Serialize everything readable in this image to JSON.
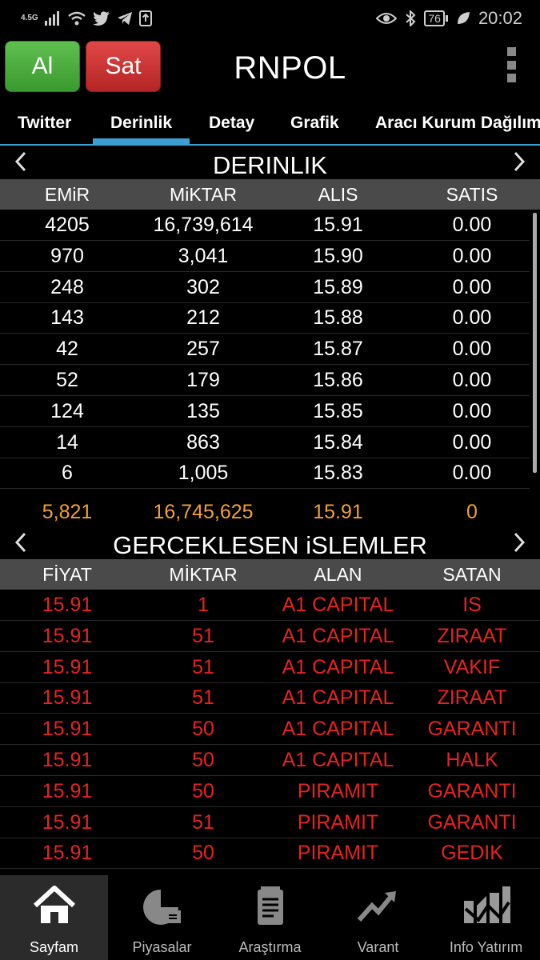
{
  "statusbar": {
    "network": "4.5G",
    "battery": "76",
    "time": "20:02"
  },
  "header": {
    "buy_label": "Al",
    "sell_label": "Sat",
    "symbol": "RNPOL"
  },
  "tabs": [
    "Twitter",
    "Derinlik",
    "Detay",
    "Grafik",
    "Aracı Kurum Dağılımı"
  ],
  "depth": {
    "title": "DERINLIK",
    "columns": [
      "EMiR",
      "MiKTAR",
      "ALIS",
      "SATIS"
    ],
    "rows": [
      [
        "4205",
        "16,739,614",
        "15.91",
        "0.00"
      ],
      [
        "970",
        "3,041",
        "15.90",
        "0.00"
      ],
      [
        "248",
        "302",
        "15.89",
        "0.00"
      ],
      [
        "143",
        "212",
        "15.88",
        "0.00"
      ],
      [
        "42",
        "257",
        "15.87",
        "0.00"
      ],
      [
        "52",
        "179",
        "15.86",
        "0.00"
      ],
      [
        "124",
        "135",
        "15.85",
        "0.00"
      ],
      [
        "14",
        "863",
        "15.84",
        "0.00"
      ],
      [
        "6",
        "1,005",
        "15.83",
        "0.00"
      ]
    ],
    "totals": [
      "5,821",
      "16,745,625",
      "15.91",
      "0"
    ]
  },
  "trades": {
    "title": "GERCEKLESEN iSLEMLER",
    "columns": [
      "FİYAT",
      "MİKTAR",
      "ALAN",
      "SATAN"
    ],
    "rows": [
      [
        "15.91",
        "1",
        "A1 CAPITAL",
        "IS"
      ],
      [
        "15.91",
        "51",
        "A1 CAPITAL",
        "ZIRAAT"
      ],
      [
        "15.91",
        "51",
        "A1 CAPITAL",
        "VAKIF"
      ],
      [
        "15.91",
        "51",
        "A1 CAPITAL",
        "ZIRAAT"
      ],
      [
        "15.91",
        "50",
        "A1 CAPITAL",
        "GARANTI"
      ],
      [
        "15.91",
        "50",
        "A1 CAPITAL",
        "HALK"
      ],
      [
        "15.91",
        "50",
        "PIRAMIT",
        "GARANTI"
      ],
      [
        "15.91",
        "51",
        "PIRAMIT",
        "GARANTI"
      ],
      [
        "15.91",
        "50",
        "PIRAMIT",
        "GEDIK"
      ]
    ]
  },
  "bottomnav": [
    {
      "label": "Sayfam",
      "icon": "home-icon"
    },
    {
      "label": "Piyasalar",
      "icon": "pie-chart-icon"
    },
    {
      "label": "Araştırma",
      "icon": "document-icon"
    },
    {
      "label": "Varant",
      "icon": "trend-arrow-icon"
    },
    {
      "label": "Info Yatırım",
      "icon": "info-logo-icon"
    }
  ],
  "colors": {
    "buy": "#3a9a2e",
    "sell": "#b52424",
    "accent": "#3da0d3",
    "totals": "#f0a030",
    "trade_text": "#e52222"
  }
}
